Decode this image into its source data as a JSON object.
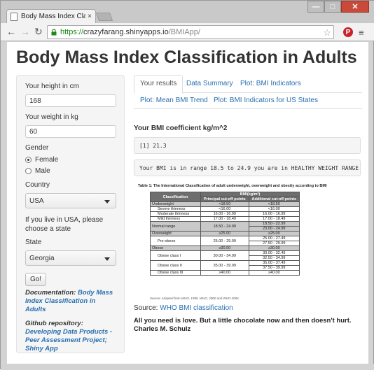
{
  "browser": {
    "tab_title": "Body Mass Index Cla",
    "tab_close": "×",
    "url_scheme": "https://",
    "url_host": "crazyfarang.shinyapps.io",
    "url_path": "/BMIApp/",
    "win_minimize": "—",
    "win_maximize": "□",
    "win_close": "✕",
    "pin_label": "P"
  },
  "page": {
    "title": "Body Mass Index Classification in Adults"
  },
  "sidebar": {
    "height_label": "Your height in cm",
    "height_value": "168",
    "weight_label": "Your weight in kg",
    "weight_value": "60",
    "gender_label": "Gender",
    "gender_options": [
      "Female",
      "Male"
    ],
    "gender_selected": "Female",
    "country_label": "Country",
    "country_value": "USA",
    "usa_note": "If you live in USA, please choose a state",
    "state_label": "State",
    "state_value": "Georgia",
    "go_label": "Go!",
    "doc_prefix": "Documentation: ",
    "doc_link": "Body Mass Index Classification in Adults",
    "repo_prefix": "Github repository: ",
    "repo_link": "Developing Data Products - Peer Assessment Project; Shiny App"
  },
  "tabs": {
    "row1": [
      "Your results",
      "Data Summary",
      "Plot: BMI Indicators"
    ],
    "row2": [
      "Plot: Mean BMI Trend",
      "Plot: BMI Indicators for US States"
    ],
    "active": "Your results"
  },
  "results": {
    "coef_heading": "Your BMI coefficient kg/m^2",
    "coef_output": "[1] 21.3",
    "range_output": "Your BMI is in range 18.5 to 24.9 you are in HEALTHY WEIGHT RANGE"
  },
  "who_table": {
    "caption": "Table 1: The International Classification of adult underweight, overweight and obesity according to BMI",
    "headers": [
      "Classification",
      "BMI(kg/m²)",
      "Principal cut-off points",
      "Additional cut-off points"
    ],
    "rows": [
      {
        "cls": "Underweight",
        "p": "<18.50",
        "a": "<18.50",
        "grey": true
      },
      {
        "cls": "Severe thinness",
        "p": "<16.00",
        "a": "<16.00",
        "grey": false
      },
      {
        "cls": "Moderate thinness",
        "p": "16.00 - 16.99",
        "a": "16.00 - 16.99",
        "grey": false
      },
      {
        "cls": "Mild thinness",
        "p": "17.00 - 18.49",
        "a": "17.00 - 18.49",
        "grey": false
      },
      {
        "cls": "Normal range",
        "p": "18.50 - 24.99",
        "a": "18.50 - 22.99",
        "a2": "23.00 - 24.99",
        "grey": true
      },
      {
        "cls": "Overweight",
        "p": "≥25.00",
        "a": "≥25.00",
        "grey": true
      },
      {
        "cls": "Pre-obese",
        "p": "25.00 - 29.99",
        "a": "25.00 - 27.49",
        "a2": "27.50 - 29.99",
        "grey": false
      },
      {
        "cls": "Obese",
        "p": "≥30.00",
        "a": "≥30.00",
        "grey": true
      },
      {
        "cls": "Obese class I",
        "p": "30.00 - 34.99",
        "a": "30.00 - 32.49",
        "a2": "32.50 - 34.99",
        "grey": false
      },
      {
        "cls": "Obese class II",
        "p": "35.00 - 39.99",
        "a": "35.00 - 37.49",
        "a2": "37.50 - 39.99",
        "grey": false
      },
      {
        "cls": "Obese class III",
        "p": "≥40.00",
        "a": "≥40.00",
        "grey": false
      }
    ],
    "source_note": "Source: Adapted from WHO, 1995, WHO, 2000 and WHO 2004."
  },
  "source": {
    "prefix": "Source: ",
    "link": "WHO BMI classification"
  },
  "quote": {
    "text": "All you need is love. But a little chocolate now and then doesn't hurt.",
    "author": "Charles M. Schulz"
  }
}
